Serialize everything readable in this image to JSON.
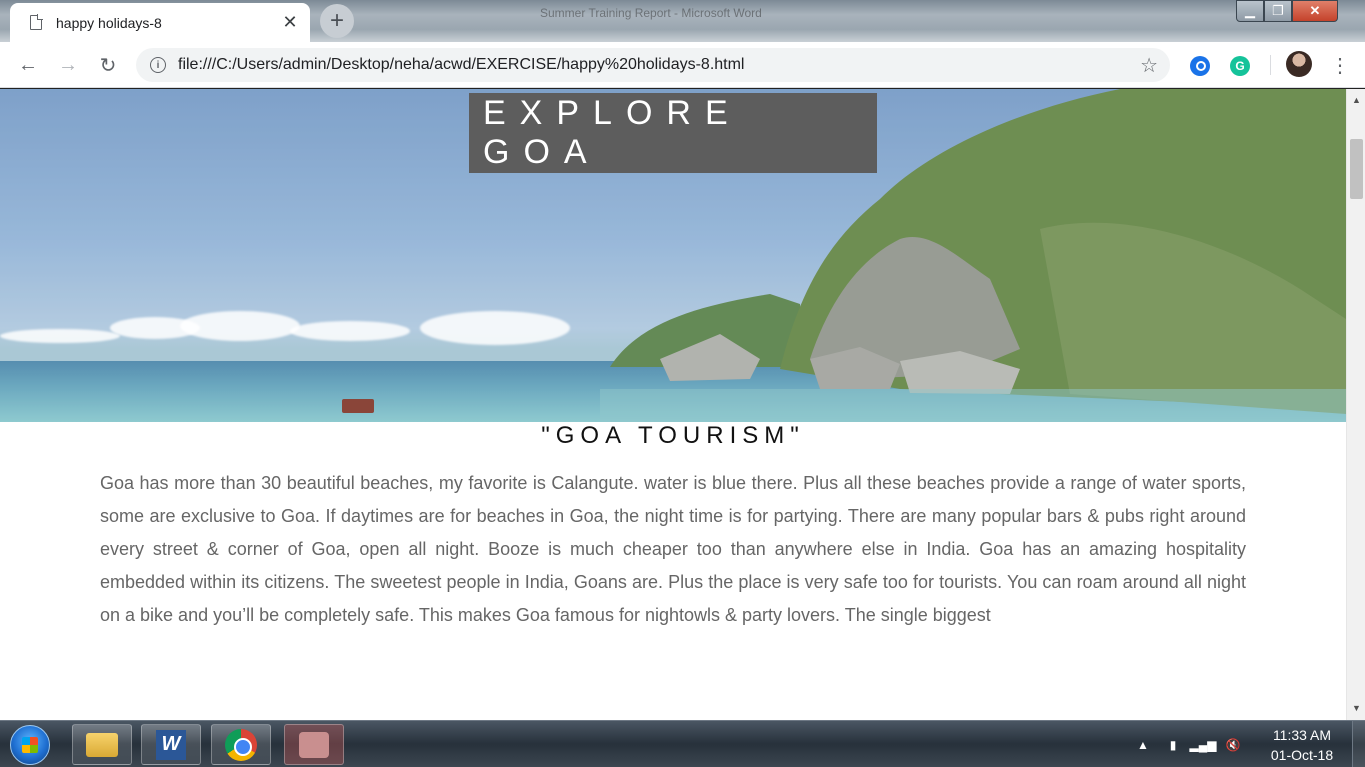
{
  "browser": {
    "tab": {
      "title": "happy holidays-8"
    },
    "background_window_title": "Summer Training Report - Microsoft Word",
    "address": {
      "url": "file:///C:/Users/admin/Desktop/neha/acwd/EXERCISE/happy%20holidays-8.html"
    },
    "icons": {
      "back": "arrow-left-icon",
      "forward": "arrow-right-icon",
      "reload": "reload-icon",
      "info": "info-icon",
      "bookmark": "star-icon",
      "menu": "more-vert-icon"
    },
    "extensions": {
      "grammarly_letter": "G"
    }
  },
  "page": {
    "hero_title": "EXPLORE GOA",
    "section_title": "\"GOA TOURISM\"",
    "section_text": "Goa has more than 30 beautiful beaches, my favorite is Calangute. water is blue there. Plus all these beaches provide a range of water sports, some are exclusive to Goa. If daytimes are for beaches in Goa, the night time is for partying. There are many popular bars & pubs right around every street & corner of Goa, open all night. Booze is much cheaper too than anywhere else in India. Goa has an amazing hospitality embedded within its citizens. The sweetest people in India, Goans are. Plus the place is very safe too for tourists. You can roam around all night on a bike and you’ll be completely safe. This makes Goa famous for nightowls & party lovers. The single biggest"
  },
  "taskbar": {
    "apps": [
      "windows-explorer",
      "microsoft-word",
      "google-chrome",
      "snipping-tool"
    ],
    "word_glyph": "W",
    "clock": {
      "time": "11:33 AM",
      "date": "01-Oct-18"
    }
  },
  "colors": {
    "title_box_bg": "#5d5d5d",
    "body_text": "#666666",
    "heading_text": "#111111"
  }
}
